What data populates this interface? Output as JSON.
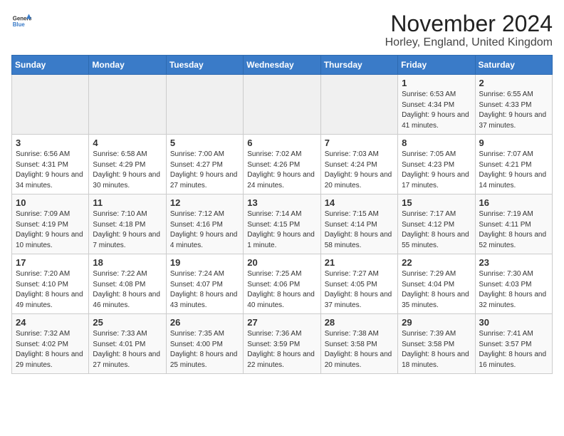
{
  "header": {
    "logo_general": "General",
    "logo_blue": "Blue",
    "month_title": "November 2024",
    "location": "Horley, England, United Kingdom"
  },
  "days_of_week": [
    "Sunday",
    "Monday",
    "Tuesday",
    "Wednesday",
    "Thursday",
    "Friday",
    "Saturday"
  ],
  "weeks": [
    [
      {
        "day": "",
        "info": ""
      },
      {
        "day": "",
        "info": ""
      },
      {
        "day": "",
        "info": ""
      },
      {
        "day": "",
        "info": ""
      },
      {
        "day": "",
        "info": ""
      },
      {
        "day": "1",
        "info": "Sunrise: 6:53 AM\nSunset: 4:34 PM\nDaylight: 9 hours and 41 minutes."
      },
      {
        "day": "2",
        "info": "Sunrise: 6:55 AM\nSunset: 4:33 PM\nDaylight: 9 hours and 37 minutes."
      }
    ],
    [
      {
        "day": "3",
        "info": "Sunrise: 6:56 AM\nSunset: 4:31 PM\nDaylight: 9 hours and 34 minutes."
      },
      {
        "day": "4",
        "info": "Sunrise: 6:58 AM\nSunset: 4:29 PM\nDaylight: 9 hours and 30 minutes."
      },
      {
        "day": "5",
        "info": "Sunrise: 7:00 AM\nSunset: 4:27 PM\nDaylight: 9 hours and 27 minutes."
      },
      {
        "day": "6",
        "info": "Sunrise: 7:02 AM\nSunset: 4:26 PM\nDaylight: 9 hours and 24 minutes."
      },
      {
        "day": "7",
        "info": "Sunrise: 7:03 AM\nSunset: 4:24 PM\nDaylight: 9 hours and 20 minutes."
      },
      {
        "day": "8",
        "info": "Sunrise: 7:05 AM\nSunset: 4:23 PM\nDaylight: 9 hours and 17 minutes."
      },
      {
        "day": "9",
        "info": "Sunrise: 7:07 AM\nSunset: 4:21 PM\nDaylight: 9 hours and 14 minutes."
      }
    ],
    [
      {
        "day": "10",
        "info": "Sunrise: 7:09 AM\nSunset: 4:19 PM\nDaylight: 9 hours and 10 minutes."
      },
      {
        "day": "11",
        "info": "Sunrise: 7:10 AM\nSunset: 4:18 PM\nDaylight: 9 hours and 7 minutes."
      },
      {
        "day": "12",
        "info": "Sunrise: 7:12 AM\nSunset: 4:16 PM\nDaylight: 9 hours and 4 minutes."
      },
      {
        "day": "13",
        "info": "Sunrise: 7:14 AM\nSunset: 4:15 PM\nDaylight: 9 hours and 1 minute."
      },
      {
        "day": "14",
        "info": "Sunrise: 7:15 AM\nSunset: 4:14 PM\nDaylight: 8 hours and 58 minutes."
      },
      {
        "day": "15",
        "info": "Sunrise: 7:17 AM\nSunset: 4:12 PM\nDaylight: 8 hours and 55 minutes."
      },
      {
        "day": "16",
        "info": "Sunrise: 7:19 AM\nSunset: 4:11 PM\nDaylight: 8 hours and 52 minutes."
      }
    ],
    [
      {
        "day": "17",
        "info": "Sunrise: 7:20 AM\nSunset: 4:10 PM\nDaylight: 8 hours and 49 minutes."
      },
      {
        "day": "18",
        "info": "Sunrise: 7:22 AM\nSunset: 4:08 PM\nDaylight: 8 hours and 46 minutes."
      },
      {
        "day": "19",
        "info": "Sunrise: 7:24 AM\nSunset: 4:07 PM\nDaylight: 8 hours and 43 minutes."
      },
      {
        "day": "20",
        "info": "Sunrise: 7:25 AM\nSunset: 4:06 PM\nDaylight: 8 hours and 40 minutes."
      },
      {
        "day": "21",
        "info": "Sunrise: 7:27 AM\nSunset: 4:05 PM\nDaylight: 8 hours and 37 minutes."
      },
      {
        "day": "22",
        "info": "Sunrise: 7:29 AM\nSunset: 4:04 PM\nDaylight: 8 hours and 35 minutes."
      },
      {
        "day": "23",
        "info": "Sunrise: 7:30 AM\nSunset: 4:03 PM\nDaylight: 8 hours and 32 minutes."
      }
    ],
    [
      {
        "day": "24",
        "info": "Sunrise: 7:32 AM\nSunset: 4:02 PM\nDaylight: 8 hours and 29 minutes."
      },
      {
        "day": "25",
        "info": "Sunrise: 7:33 AM\nSunset: 4:01 PM\nDaylight: 8 hours and 27 minutes."
      },
      {
        "day": "26",
        "info": "Sunrise: 7:35 AM\nSunset: 4:00 PM\nDaylight: 8 hours and 25 minutes."
      },
      {
        "day": "27",
        "info": "Sunrise: 7:36 AM\nSunset: 3:59 PM\nDaylight: 8 hours and 22 minutes."
      },
      {
        "day": "28",
        "info": "Sunrise: 7:38 AM\nSunset: 3:58 PM\nDaylight: 8 hours and 20 minutes."
      },
      {
        "day": "29",
        "info": "Sunrise: 7:39 AM\nSunset: 3:58 PM\nDaylight: 8 hours and 18 minutes."
      },
      {
        "day": "30",
        "info": "Sunrise: 7:41 AM\nSunset: 3:57 PM\nDaylight: 8 hours and 16 minutes."
      }
    ]
  ]
}
